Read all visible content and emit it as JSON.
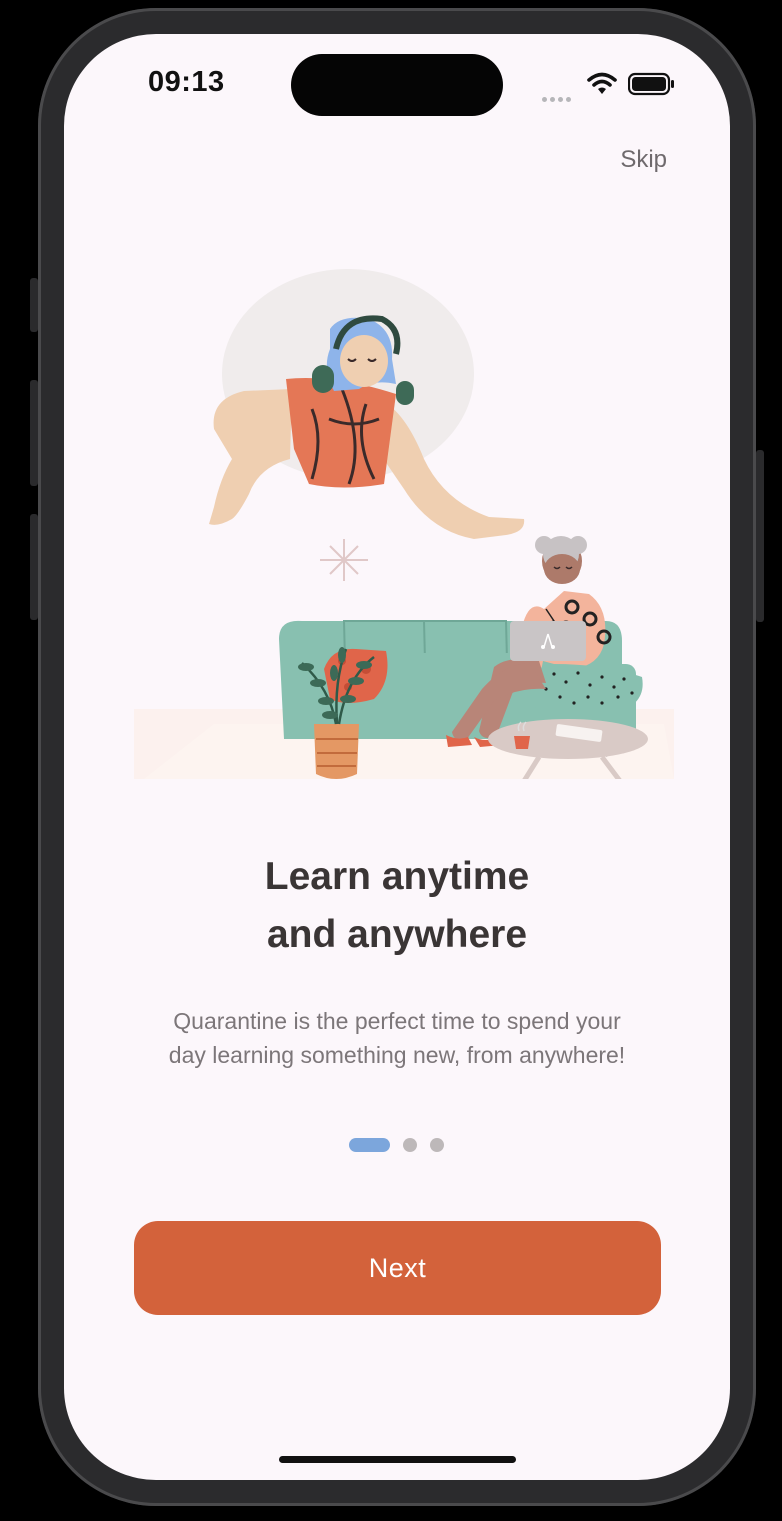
{
  "status_bar": {
    "time": "09:13"
  },
  "header": {
    "skip_label": "Skip"
  },
  "onboarding": {
    "title_line1": "Learn anytime",
    "title_line2": "and anywhere",
    "description_line1": "Quarantine is the perfect time to spend your",
    "description_line2": "day learning something new, from anywhere!",
    "page_indicator": {
      "total": 3,
      "current": 1
    },
    "next_label": "Next",
    "colors": {
      "accent": "#d3623b",
      "indicator_active": "#7ca6dc",
      "indicator_inactive": "#bdb8b9",
      "background": "#fcf7fb"
    }
  },
  "icons": [
    "cellular-signal-icon",
    "wifi-icon",
    "battery-icon"
  ]
}
